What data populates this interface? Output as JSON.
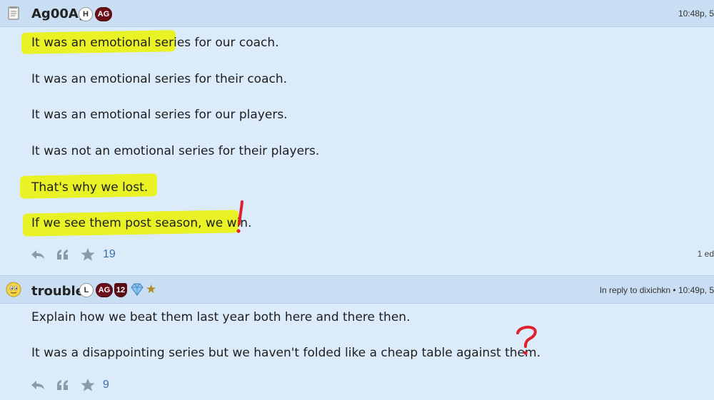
{
  "post1": {
    "username": "Ag00Ag",
    "badges": {
      "h": "H",
      "ag": "AG"
    },
    "timestamp": "10:48p, 5",
    "lines": [
      "It was an emotional series for our coach.",
      "It was an emotional series for their coach.",
      "It was an emotional series for our players.",
      "It was not an emotional series for their players.",
      "That's why we lost.",
      "If we see them post season, we win."
    ],
    "likes": "19",
    "edit_note": "1 ed"
  },
  "post2": {
    "username": "trouble",
    "badges": {
      "l": "L",
      "ag": "AG",
      "level": "12"
    },
    "reply_info": "In reply to dixichkn • 10:49p, 5",
    "lines": [
      "Explain how we beat them last year both here and there then.",
      "It was a disappointing series but we haven't folded like a cheap table against them."
    ],
    "likes": "9"
  },
  "colors": {
    "background": "#dcebfa",
    "header": "#c9def3",
    "highlight": "#e8f224",
    "annotation": "#e0202a",
    "badge_maroon": "#6b0f1a",
    "like_blue": "#3a6ea5"
  }
}
